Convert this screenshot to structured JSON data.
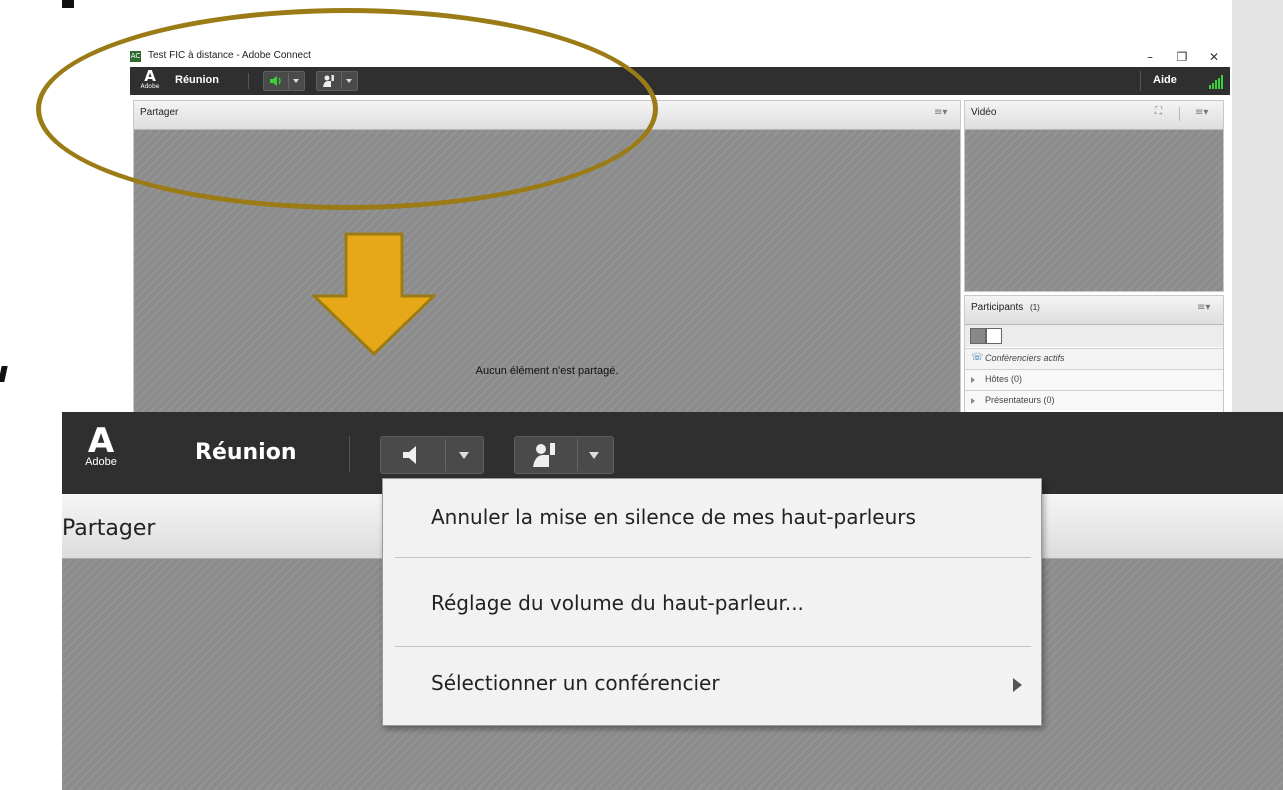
{
  "window": {
    "title": "Test FIC à distance - Adobe Connect",
    "app_icon_label": "AC",
    "controls": {
      "minimize": "–",
      "restore": "❐",
      "close": "✕"
    }
  },
  "toolbar": {
    "logo_mark": "A",
    "logo_text": "Adobe",
    "menu_reunion": "Réunion",
    "help": "Aide",
    "speaker_active_color": "#3bd13b"
  },
  "share_pod": {
    "title": "Partager",
    "empty_message": "Aucun élément n'est partagé.",
    "menu_glyph": "≡▾"
  },
  "video_pod": {
    "title": "Vidéo",
    "menu_glyph": "≡▾",
    "fullscreen_glyph": "⛶"
  },
  "participants_pod": {
    "title": "Participants",
    "count": "(1)",
    "menu_glyph": "≡▾",
    "rows": [
      {
        "label": "Conférenciers actifs",
        "icon": "phone-icon"
      },
      {
        "label": "Hôtes (0)",
        "icon": "expand-arrow-icon"
      },
      {
        "label": "Présentateurs (0)",
        "icon": "expand-arrow-icon"
      }
    ]
  },
  "zoom": {
    "logo_mark": "A",
    "logo_text": "Adobe",
    "menu_reunion": "Réunion",
    "share_title": "Partager"
  },
  "speaker_menu": {
    "items": [
      {
        "label": "Annuler la mise en silence de mes haut-parleurs"
      },
      {
        "label": "Réglage du volume du haut-parleur..."
      },
      {
        "label": "Sélectionner un conférencier",
        "has_submenu": true
      }
    ]
  },
  "annotation": {
    "highlight_color": "#9a7b16",
    "arrow_color": "#e6a817"
  }
}
